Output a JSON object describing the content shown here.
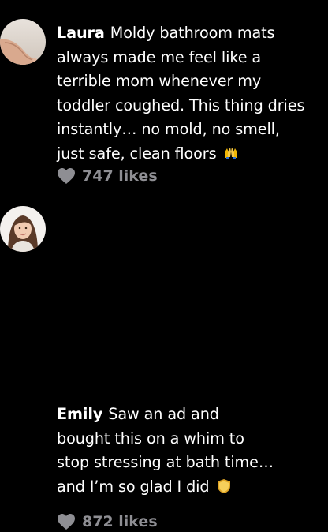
{
  "comments": [
    {
      "author": "Laura",
      "lines": [
        "Moldy bathroom mats",
        "always made me feel like a",
        "terrible mom whenever my",
        "toddler coughed. This thing dries",
        "instantly…  no mold, no smell,",
        "just safe, clean floors"
      ],
      "emoji": "raised-hands-emoji",
      "likes": "747 likes"
    },
    {
      "author": "Emily",
      "lines": [
        "Saw an ad and",
        "bought this on a whim to",
        "stop stressing at bath time…",
        "and I’m so glad I did"
      ],
      "emoji": "shield-emoji",
      "likes": "872 likes"
    }
  ],
  "colors": {
    "background": "#000000",
    "text": "#ffffff",
    "muted": "#8e8e93"
  },
  "icons": {
    "like": "heart-icon"
  }
}
